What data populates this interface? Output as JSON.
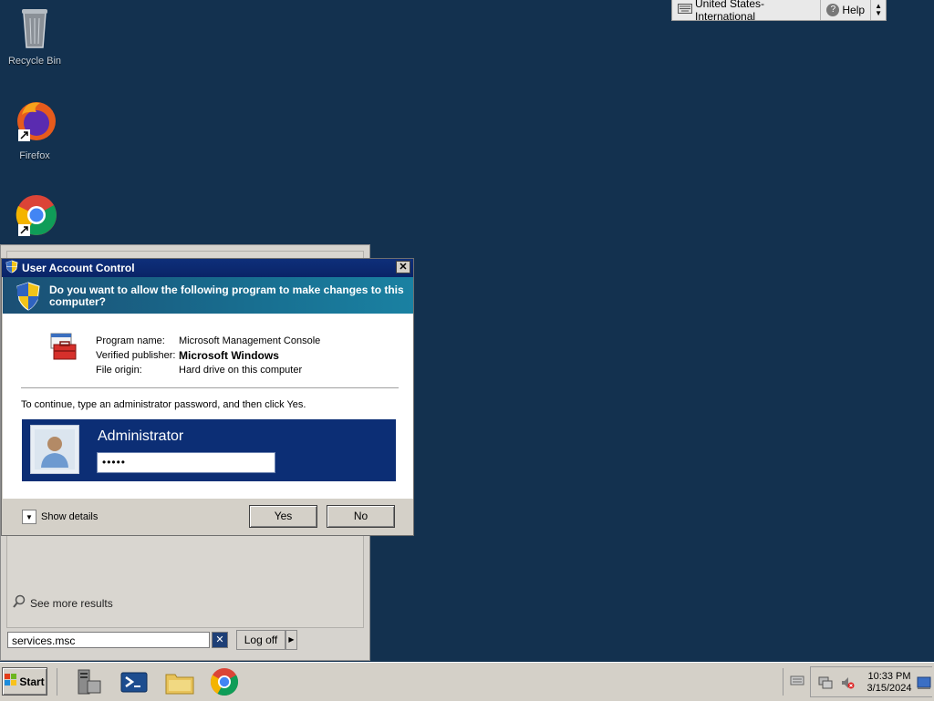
{
  "desktop": {
    "icons": [
      {
        "label": "Recycle Bin"
      },
      {
        "label": "Firefox"
      },
      {
        "label": ""
      }
    ]
  },
  "langbar": {
    "language": "United States-International",
    "help": "Help"
  },
  "uac": {
    "title": "User Account Control",
    "question": "Do you want to allow the following program to make changes to this computer?",
    "program_label": "Program name:",
    "program_value": "Microsoft Management Console",
    "publisher_label": "Verified publisher:",
    "publisher_value": "Microsoft Windows",
    "origin_label": "File origin:",
    "origin_value": "Hard drive on this computer",
    "instruction": "To continue, type an administrator password, and then click Yes.",
    "username": "Administrator",
    "password_mask": "•••••",
    "show_details": "Show details",
    "yes": "Yes",
    "no": "No"
  },
  "startmenu": {
    "see_more": "See more results",
    "search_value": "services.msc",
    "logoff": "Log off"
  },
  "taskbar": {
    "start": "Start",
    "time": "10:33 PM",
    "date": "3/15/2024"
  }
}
